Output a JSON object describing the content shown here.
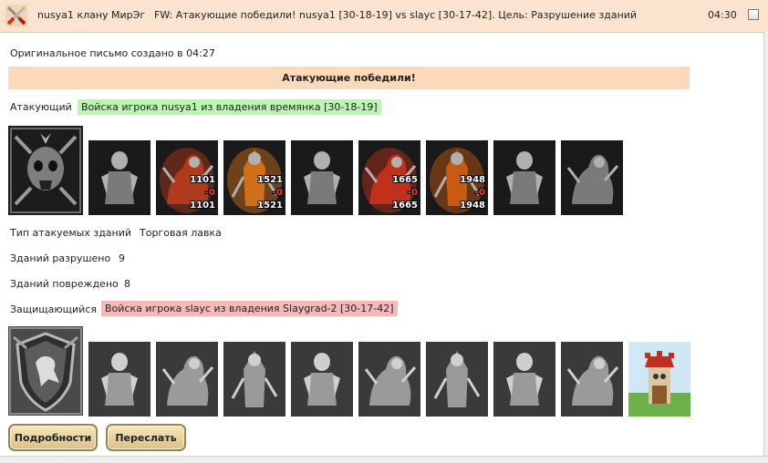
{
  "header": {
    "from": "nusya1 клану МирЭг",
    "subject": "FW: Атакующие победили! nusya1 [30-18-19] vs slayc [30-17-42]. Цель: Разрушение зданий",
    "time": "04:30"
  },
  "letter": {
    "original_created": "Оригинальное письмо создано в 04:27",
    "result": "Атакующие победили!"
  },
  "attacker": {
    "label": "Атакующий",
    "army": "Войска игрока nusya1 из владения времянка [30-18-19]",
    "units": [
      {
        "name": "black-dragon-icon"
      },
      {
        "name": "fire-skeleton-icon",
        "count": "1101",
        "lost": "-0",
        "remain": "1101",
        "color": "#b23a1c"
      },
      {
        "name": "fire-demon-icon",
        "count": "1521",
        "lost": "-0",
        "remain": "1521",
        "color": "#d2701a"
      },
      {
        "name": "gargoyle-icon"
      },
      {
        "name": "fire-elemental-icon",
        "count": "1665",
        "lost": "-0",
        "remain": "1665",
        "color": "#c0301a"
      },
      {
        "name": "fire-monk-icon",
        "count": "1948",
        "lost": "-0",
        "remain": "1948",
        "color": "#c85a12"
      },
      {
        "name": "orc-warrior-icon"
      },
      {
        "name": "reaper-icon"
      }
    ]
  },
  "buildings": {
    "type_label": "Тип атакуемых зданий",
    "type_value": "Торговая лавка",
    "destroyed_label": "Зданий разрушено",
    "destroyed_value": "9",
    "damaged_label": "Зданий повреждено",
    "damaged_value": "8"
  },
  "defender": {
    "label": "Защищающийся",
    "army": "Войска игрока slayc из владения Slaygrad-2 [30-17-42]",
    "units": [
      {
        "name": "mounted-knight-icon"
      },
      {
        "name": "foot-soldier-icon"
      },
      {
        "name": "cavalry-icon"
      },
      {
        "name": "griffin-icon"
      },
      {
        "name": "crossbowman-icon"
      },
      {
        "name": "hooded-monk-icon"
      },
      {
        "name": "swordsman-icon"
      },
      {
        "name": "elder-mage-icon"
      },
      {
        "name": "watchtower-icon"
      }
    ]
  },
  "buttons": {
    "details": "Подробности",
    "forward": "Переслать"
  }
}
